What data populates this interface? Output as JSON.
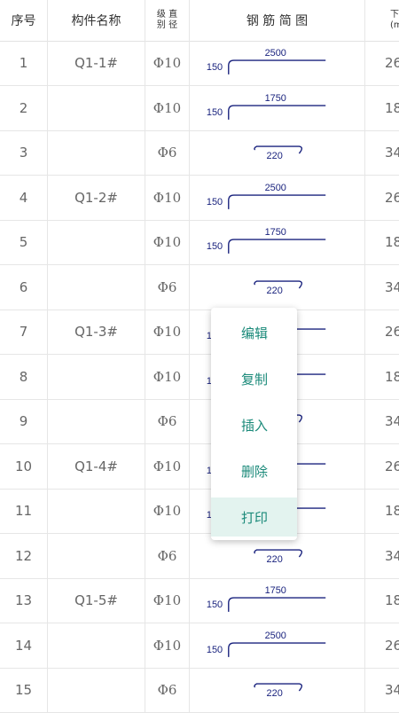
{
  "header": {
    "col_seq": "序号",
    "col_name": "构件名称",
    "col_grade_line1": "级 直",
    "col_grade_line2": "别 径",
    "col_diagram": "钢 筋 简 图",
    "col_last_line1": "下",
    "col_last_line2": "(m"
  },
  "rows": [
    {
      "seq": "1",
      "name": "Q1-1#",
      "grade": "Φ10",
      "shape": "hook",
      "h": "150",
      "l": "2500",
      "last": "26"
    },
    {
      "seq": "2",
      "name": "",
      "grade": "Φ10",
      "shape": "hook",
      "h": "150",
      "l": "1750",
      "last": "18"
    },
    {
      "seq": "3",
      "name": "",
      "grade": "Φ6",
      "shape": "stirrup",
      "l": "220",
      "last": "34"
    },
    {
      "seq": "4",
      "name": "Q1-2#",
      "grade": "Φ10",
      "shape": "hook",
      "h": "150",
      "l": "2500",
      "last": "26"
    },
    {
      "seq": "5",
      "name": "",
      "grade": "Φ10",
      "shape": "hook",
      "h": "150",
      "l": "1750",
      "last": "18"
    },
    {
      "seq": "6",
      "name": "",
      "grade": "Φ6",
      "shape": "stirrup",
      "l": "220",
      "last": "34"
    },
    {
      "seq": "7",
      "name": "Q1-3#",
      "grade": "Φ10",
      "shape": "hook",
      "h": "15",
      "l": "",
      "last": "26"
    },
    {
      "seq": "8",
      "name": "",
      "grade": "Φ10",
      "shape": "hook",
      "h": "15",
      "l": "",
      "last": "18"
    },
    {
      "seq": "9",
      "name": "",
      "grade": "Φ6",
      "shape": "stirrup-part",
      "l": "",
      "last": "34"
    },
    {
      "seq": "10",
      "name": "Q1-4#",
      "grade": "Φ10",
      "shape": "hook",
      "h": "15",
      "l": "",
      "last": "26"
    },
    {
      "seq": "11",
      "name": "",
      "grade": "Φ10",
      "shape": "hook",
      "h": "15",
      "l": "",
      "last": "18"
    },
    {
      "seq": "12",
      "name": "",
      "grade": "Φ6",
      "shape": "stirrup",
      "l": "220",
      "last": "34"
    },
    {
      "seq": "13",
      "name": "Q1-5#",
      "grade": "Φ10",
      "shape": "hook",
      "h": "150",
      "l": "1750",
      "last": "18"
    },
    {
      "seq": "14",
      "name": "",
      "grade": "Φ10",
      "shape": "hook",
      "h": "150",
      "l": "2500",
      "last": "26"
    },
    {
      "seq": "15",
      "name": "",
      "grade": "Φ6",
      "shape": "stirrup",
      "l": "220",
      "last": "34"
    }
  ],
  "menu": {
    "items": [
      "编辑",
      "复制",
      "插入",
      "删除",
      "打印"
    ],
    "active_index": 4
  },
  "colors": {
    "diagram_stroke": "#1a237e",
    "menu_text": "#1b8a7a",
    "menu_active_bg": "#e3f3ef"
  }
}
